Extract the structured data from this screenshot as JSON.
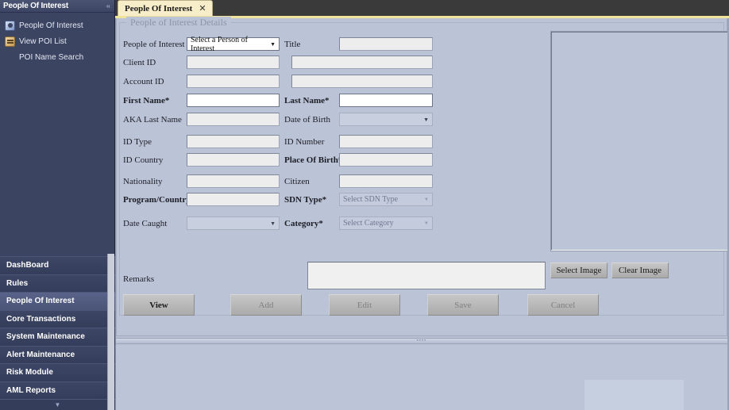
{
  "sidebar": {
    "header_title": "People Of Interest",
    "collapse_icon": "chevron-double-left-icon",
    "tree": [
      {
        "label": "People Of Interest",
        "icon": "people-icon",
        "child": false
      },
      {
        "label": "View POI List",
        "icon": "list-icon",
        "child": false
      },
      {
        "label": "POI Name Search",
        "icon": "none",
        "child": true
      }
    ],
    "menu": [
      {
        "label": "DashBoard",
        "active": false
      },
      {
        "label": "Rules",
        "active": false
      },
      {
        "label": "People Of Interest",
        "active": true
      },
      {
        "label": "Core Transactions",
        "active": false
      },
      {
        "label": "System Maintenance",
        "active": false
      },
      {
        "label": "Alert Maintenance",
        "active": false
      },
      {
        "label": "Risk Module",
        "active": false
      },
      {
        "label": "AML Reports",
        "active": false
      }
    ],
    "scroll_down_icon": "chevron-down-icon"
  },
  "tab": {
    "label": "People Of Interest",
    "close_icon": "close-icon"
  },
  "form": {
    "legend": "People of Interest Details",
    "labels": {
      "people_of_interest": "People of Interest",
      "title": "Title",
      "client_id": "Client ID",
      "account_id": "Account ID",
      "first_name": "First Name*",
      "last_name": "Last Name*",
      "aka_last_name": "AKA Last Name",
      "date_of_birth": "Date of Birth",
      "id_type": "ID Type",
      "id_number": "ID Number",
      "id_country": "ID Country",
      "place_of_birth": "Place Of Birth*",
      "nationality": "Nationality",
      "citizen": "Citizen",
      "program_country": "Program/Country*",
      "sdn_type": "SDN Type*",
      "category": "Category*",
      "date_caught": "Date Caught",
      "remarks": "Remarks"
    },
    "values": {
      "people_of_interest": "Select a Person of Interest",
      "title": "",
      "client_id": "",
      "client_id_extra": "",
      "account_id": "",
      "account_id_extra": "",
      "first_name": "",
      "last_name": "",
      "aka_last_name": "",
      "date_of_birth": "",
      "id_type": "",
      "id_number": "",
      "id_country": "",
      "place_of_birth": "",
      "nationality": "",
      "citizen": "",
      "program_country": "",
      "sdn_type": "Select SDN Type",
      "category": "Select Category",
      "date_caught": "",
      "remarks": ""
    }
  },
  "buttons": {
    "select_image": "Select Image",
    "clear_image": "Clear Image",
    "view": "View",
    "add": "Add",
    "edit": "Edit",
    "save": "Save",
    "cancel": "Cancel"
  },
  "splitter": {
    "grip": "••••"
  }
}
